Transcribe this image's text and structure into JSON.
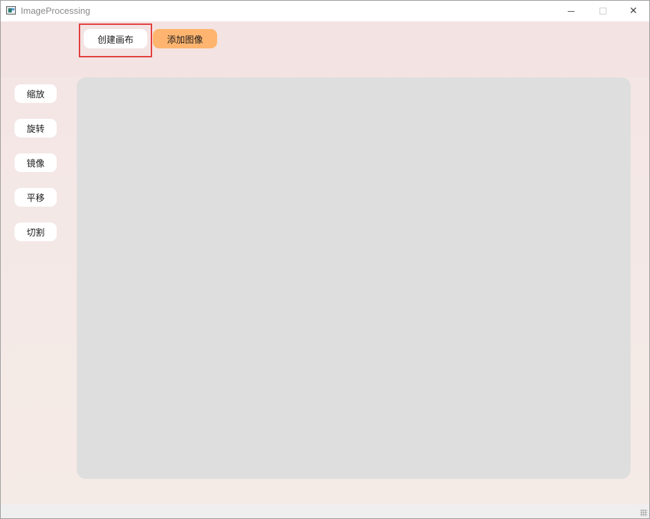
{
  "window": {
    "title": "ImageProcessing",
    "controls": {
      "minimize_icon": "minimize-icon",
      "maximize_icon": "maximize-icon",
      "close_label": "✕"
    }
  },
  "toolbar": {
    "create_canvas_label": "创建画布",
    "add_image_label": "添加图像",
    "create_canvas_highlighted": true
  },
  "sidebar": {
    "items": [
      {
        "label": "缩放"
      },
      {
        "label": "旋转"
      },
      {
        "label": "镜像"
      },
      {
        "label": "平移"
      },
      {
        "label": "切割"
      }
    ]
  },
  "colors": {
    "accent_button": "#ffb56f",
    "highlight_border": "#e23c3c",
    "canvas_bg": "#dedede",
    "toolbar_bg": "#f3e3e2"
  }
}
